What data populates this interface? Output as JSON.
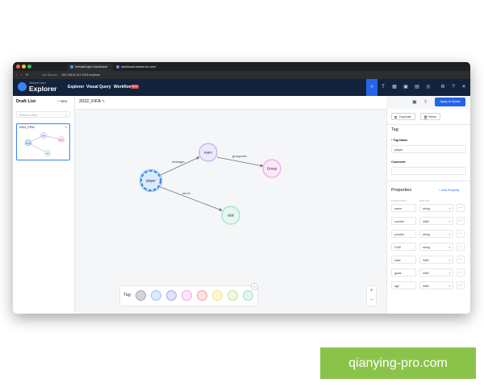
{
  "browser": {
    "tabs": [
      "NebulaGraph Dashboard",
      "dashboard.nebula-inc.com/"
    ],
    "not_secure": "Not Secure",
    "url": "192.168.8.131:7001/explorer"
  },
  "app": {
    "logo_small": "NebulaGraph",
    "logo_name": "Explorer",
    "nav": [
      "Explorer",
      "Visual Query",
      "Workflow"
    ],
    "workflow_badge": "Beta",
    "toolbar_icons": [
      "schema-icon",
      "text-icon",
      "table-icon",
      "save-icon",
      "graph-icon",
      "db-icon",
      "settings-icon",
      "help-icon",
      "user-icon"
    ]
  },
  "left_panel": {
    "title": "Draft List",
    "new_label": "New",
    "search_placeholder": "Search name",
    "draft": {
      "name": "2022_FIFA",
      "mini_nodes": [
        "team",
        "player",
        "group",
        "club"
      ]
    }
  },
  "canvas": {
    "draft_title": "2022_FIFA",
    "apply_button": "Apply to Space",
    "nodes": [
      {
        "label": "team",
        "color": "#b8b2ee",
        "fill": "#ece9fb"
      },
      {
        "label": "player",
        "color": "#3b8bd8",
        "fill": "#dbeafe"
      },
      {
        "label": "Group",
        "color": "#f0a8e8",
        "fill": "#fbe7f8"
      },
      {
        "label": "club",
        "color": "#9fe0c8",
        "fill": "#e6f7ef"
      }
    ],
    "edges": [
      {
        "label": "belongto",
        "from": "player",
        "to": "team"
      },
      {
        "label": "groupedin",
        "from": "team",
        "to": "Group"
      },
      {
        "label": "serve",
        "from": "player",
        "to": "club"
      }
    ]
  },
  "tagbar": {
    "label": "Tag",
    "colors": [
      {
        "border": "#9ca3af",
        "fill": "#d1d5db"
      },
      {
        "border": "#93c5fd",
        "fill": "#dbeafe"
      },
      {
        "border": "#a5a0ea",
        "fill": "#e4e2fb"
      },
      {
        "border": "#f0a8e8",
        "fill": "#fbe7f8"
      },
      {
        "border": "#f5a3a3",
        "fill": "#fde2e2"
      },
      {
        "border": "#f2e48a",
        "fill": "#fdf7d6"
      },
      {
        "border": "#bde58f",
        "fill": "#eef8e1"
      },
      {
        "border": "#9fe0c8",
        "fill": "#e2f6ee"
      }
    ]
  },
  "right_panel": {
    "duplicate": "Duplicate",
    "delete": "Delete",
    "section_tag": "Tag",
    "tag_name_label": "* Tag Name",
    "tag_name_value": "player",
    "comment_label": "Comment",
    "comment_value": "",
    "section_properties": "Properties",
    "add_property": "+ Add Property",
    "col_name": "Property Name",
    "col_type": "Data Type",
    "properties": [
      {
        "name": "name",
        "type": "string"
      },
      {
        "name": "number",
        "type": "int64"
      },
      {
        "name": "position",
        "type": "string"
      },
      {
        "name": "DOB",
        "type": "string"
      },
      {
        "name": "caps",
        "type": "int64"
      },
      {
        "name": "goals",
        "type": "int64"
      },
      {
        "name": "age",
        "type": "int64"
      }
    ]
  },
  "watermark": "qianying-pro.com"
}
